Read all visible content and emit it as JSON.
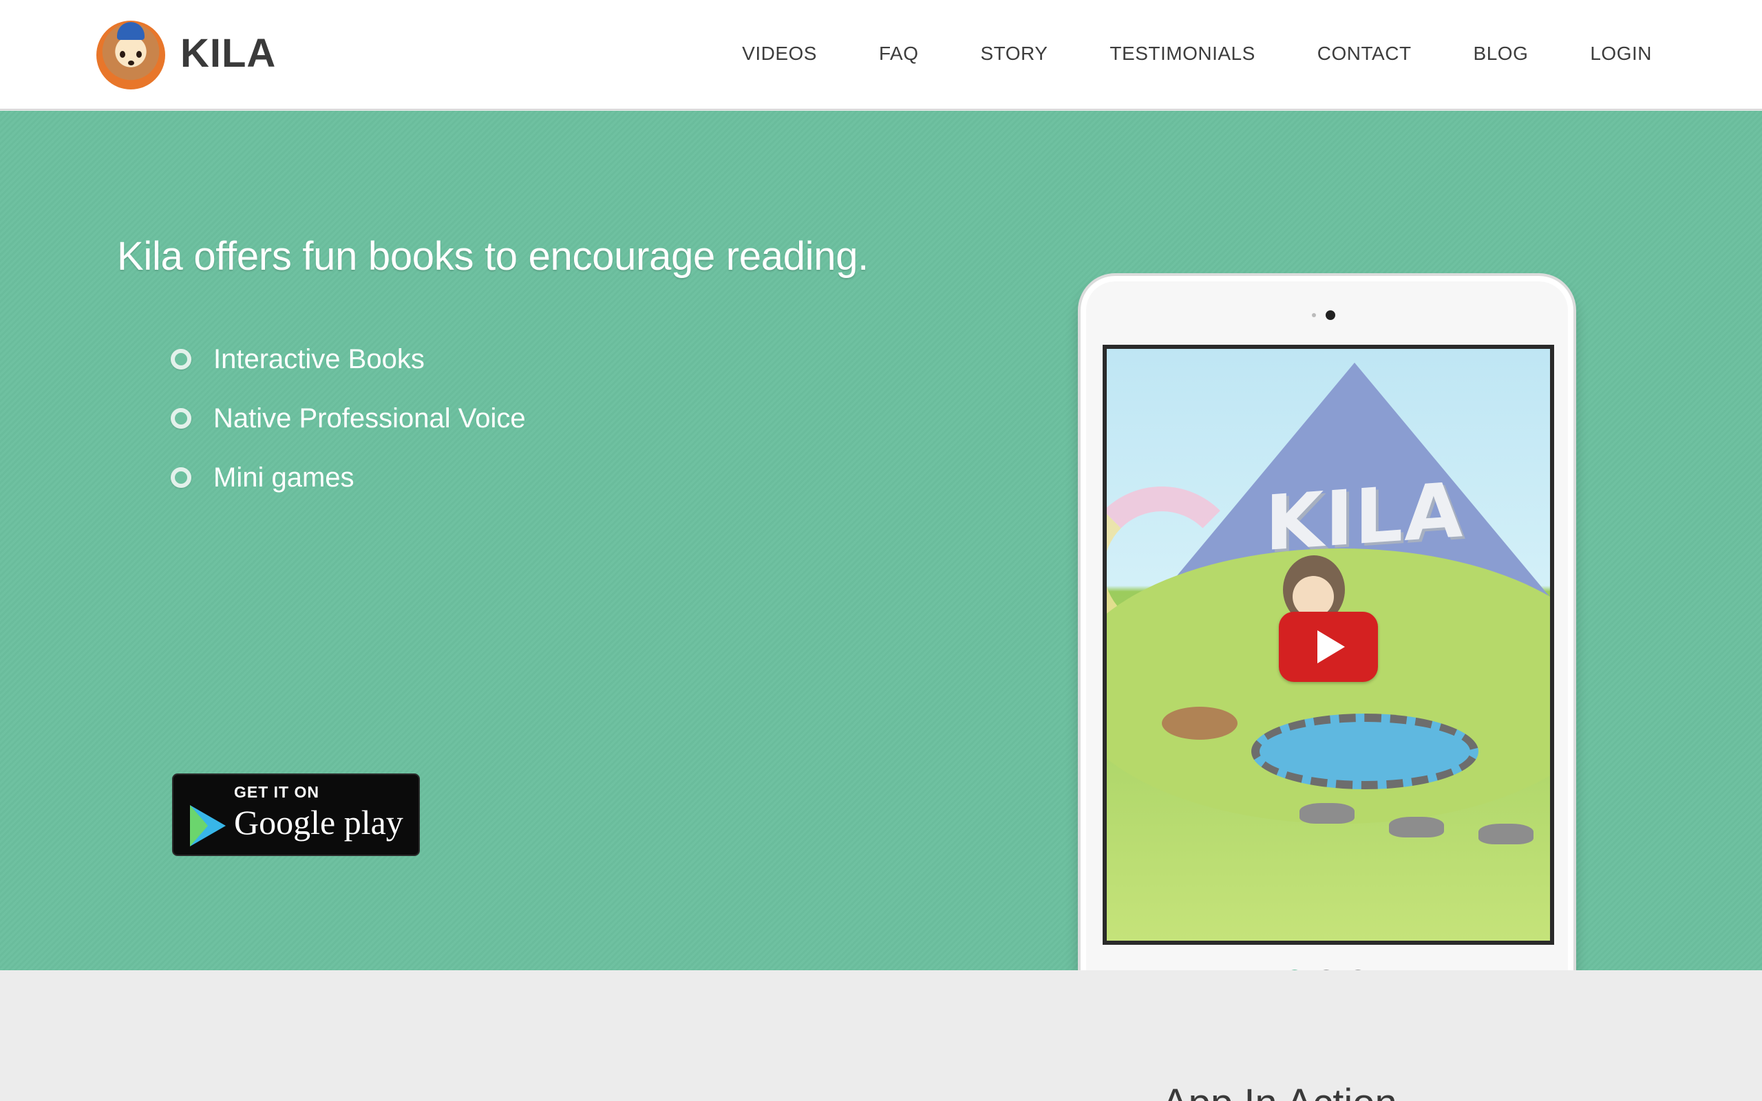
{
  "header": {
    "brand": "KILA",
    "nav": [
      "VIDEOS",
      "FAQ",
      "STORY",
      "TESTIMONIALS",
      "CONTACT",
      "BLOG",
      "LOGIN"
    ]
  },
  "hero": {
    "title": "Kila offers fun books to encourage reading.",
    "features": [
      "Interactive Books",
      "Native Professional Voice",
      "Mini games"
    ],
    "google_play": {
      "small": "GET IT ON",
      "big": "Google play"
    },
    "screen_sign": "KILA",
    "carousel": {
      "slides": 3,
      "active": 0
    }
  },
  "section2": {
    "title": "App In Action"
  },
  "colors": {
    "hero_bg": "#6cc09f",
    "play_red": "#d42121",
    "header_bg": "#ffffff"
  },
  "icons": [
    "logo-hedgehog-icon",
    "circle-bullet-icon",
    "google-play-icon",
    "youtube-play-icon"
  ]
}
